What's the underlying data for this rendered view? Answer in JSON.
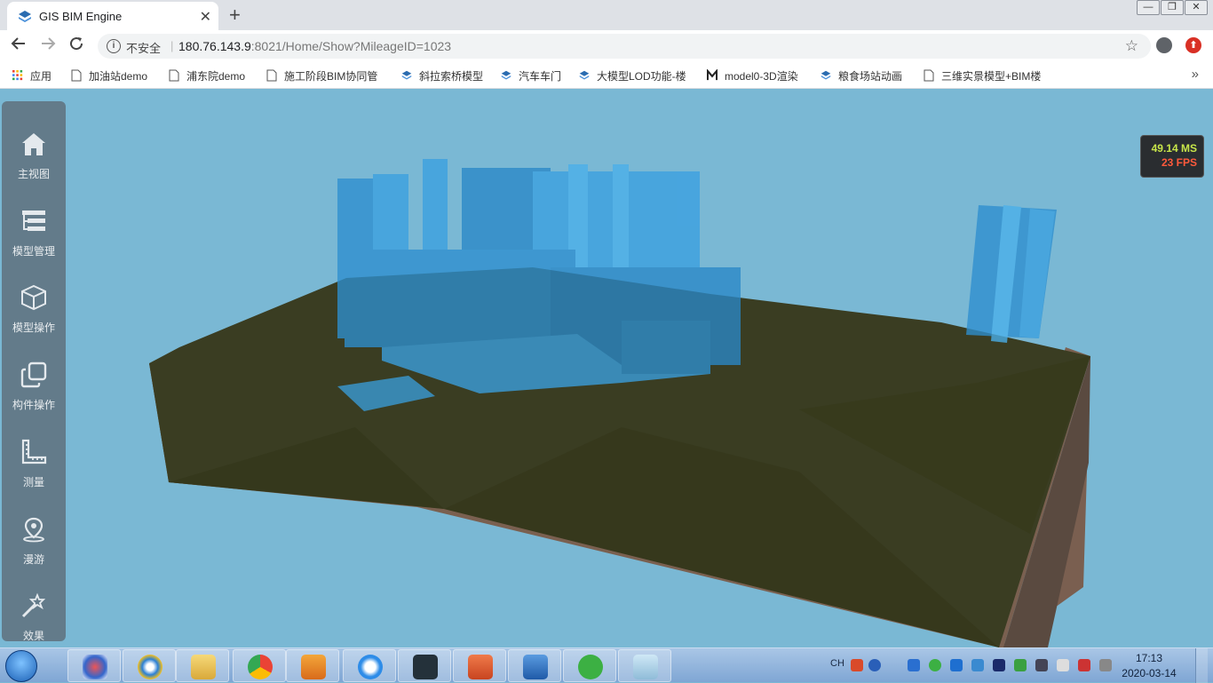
{
  "browser": {
    "tab_title": "GIS BIM Engine",
    "tab_close": "✕",
    "new_tab": "+",
    "insecure_label": "不安全",
    "separator": "|",
    "url_host": "180.76.143.9",
    "url_rest": ":8021/Home/Show?MileageID=1023",
    "star": "☆",
    "ext_badge": "⬆",
    "win_controls": [
      "—",
      "❐",
      "✕"
    ]
  },
  "bookmarks": [
    "应用",
    "加油站demo",
    "浦东院demo",
    "施工阶段BIM协同管",
    "斜拉索桥模型",
    "汽车车门",
    "大模型LOD功能-楼",
    "model0-3D渲染",
    "粮食场站动画",
    "三维实景模型+BIM楼"
  ],
  "bookmarks_more": "»",
  "sidebar": {
    "items": [
      {
        "label": "主视图",
        "icon": "home-icon"
      },
      {
        "label": "模型管理",
        "icon": "model-tree-icon"
      },
      {
        "label": "模型操作",
        "icon": "cube-icon"
      },
      {
        "label": "构件操作",
        "icon": "component-copy-icon"
      },
      {
        "label": "测量",
        "icon": "ruler-icon"
      },
      {
        "label": "漫游",
        "icon": "location-pin-icon"
      },
      {
        "label": "效果",
        "icon": "magic-wand-icon"
      }
    ]
  },
  "stats": {
    "ms": "49.14 MS",
    "fps": "23 FPS"
  },
  "taskbar": {
    "tray_lang": "CH",
    "time": "17:13",
    "date": "2020-03-14"
  },
  "colors": {
    "sky": "#7ab8d4",
    "terrain_top": "#3a3d22",
    "terrain_side": "#7a5f50",
    "building": "#2e8fcf"
  }
}
